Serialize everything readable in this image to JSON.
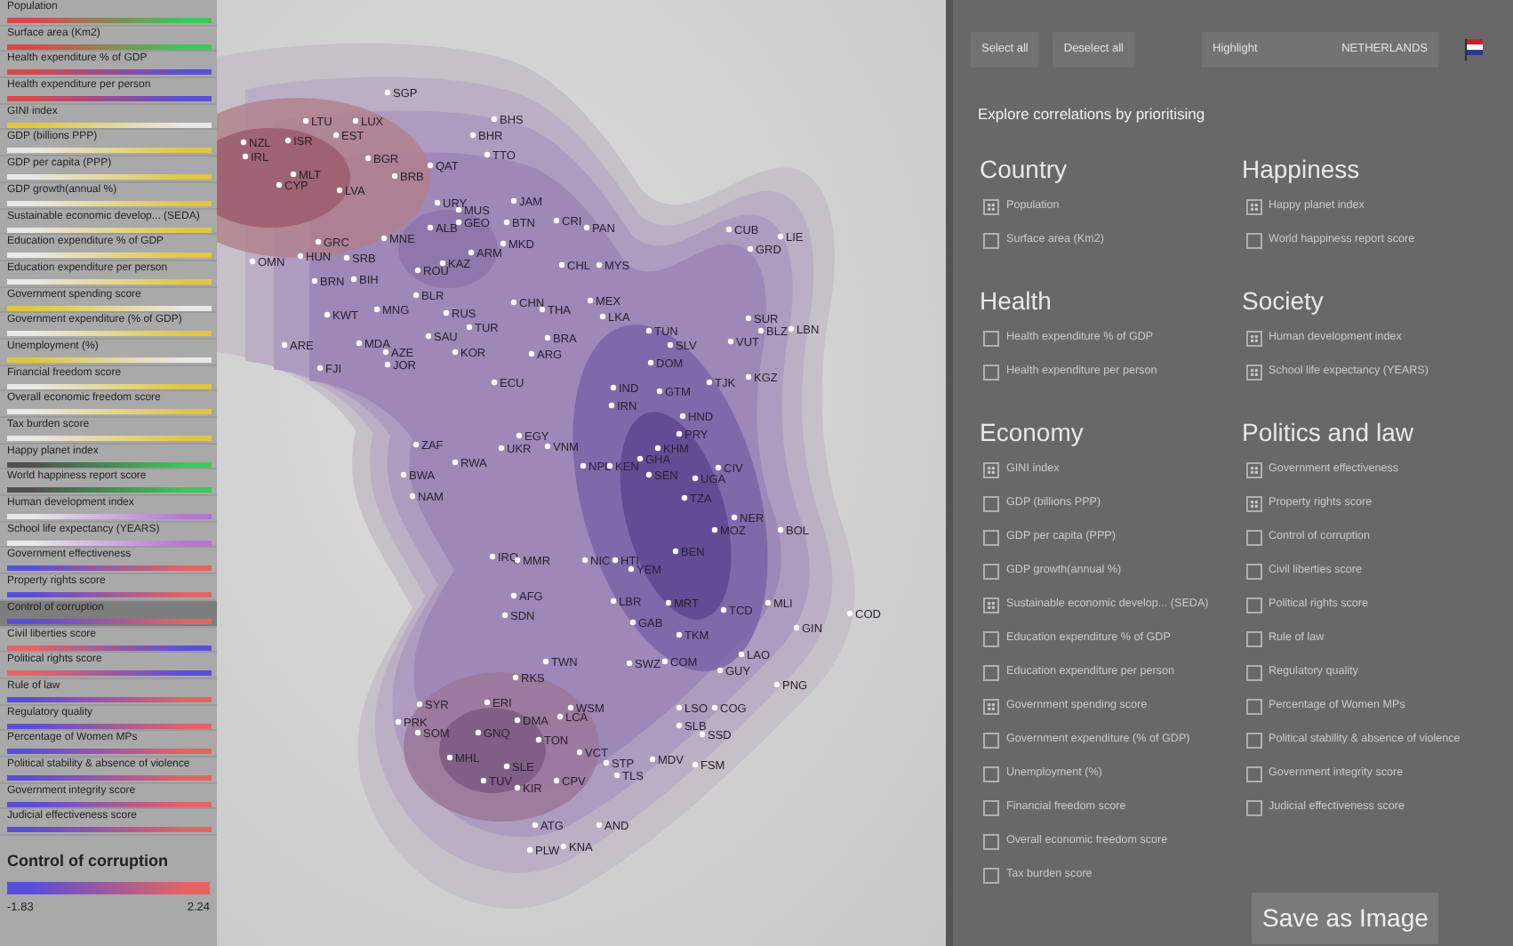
{
  "sidebar": {
    "variables": [
      {
        "label": "Population",
        "gradient": [
          {
            "color": "#d94848"
          },
          {
            "color": "#3cc85a"
          }
        ],
        "selected": false
      },
      {
        "label": "Surface area (Km2)",
        "gradient": [
          {
            "color": "#d94848"
          },
          {
            "color": "#3cc85a"
          }
        ],
        "selected": false
      },
      {
        "label": "Health expenditure % of GDP",
        "gradient": [
          {
            "color": "#d94848"
          },
          {
            "color": "#5a4ed8"
          }
        ],
        "selected": false
      },
      {
        "label": "Health expenditure per person",
        "gradient": [
          {
            "color": "#d94848"
          },
          {
            "color": "#5a4ed8"
          }
        ],
        "selected": false
      },
      {
        "label": "GINI index",
        "gradient": [
          {
            "color": "#e0c640"
          },
          {
            "color": "#e8e8e8"
          }
        ],
        "selected": false
      },
      {
        "label": "GDP (billions PPP)",
        "gradient": [
          {
            "color": "#e8e8e8"
          },
          {
            "color": "#e0c640"
          }
        ],
        "selected": false
      },
      {
        "label": "GDP per capita (PPP)",
        "gradient": [
          {
            "color": "#e8e8e8"
          },
          {
            "color": "#e0c640"
          }
        ],
        "selected": false
      },
      {
        "label": "GDP growth(annual %)",
        "gradient": [
          {
            "color": "#e8e8e8"
          },
          {
            "color": "#e0c640"
          }
        ],
        "selected": false
      },
      {
        "label": "Sustainable economic develop... (SEDA)",
        "gradient": [
          {
            "color": "#e8e8e8"
          },
          {
            "color": "#e0c640"
          }
        ],
        "selected": false
      },
      {
        "label": "Education expenditure % of GDP",
        "gradient": [
          {
            "color": "#e8e8e8"
          },
          {
            "color": "#e0c640"
          }
        ],
        "selected": false
      },
      {
        "label": "Education expenditure per person",
        "gradient": [
          {
            "color": "#e8e8e8"
          },
          {
            "color": "#e0c640"
          }
        ],
        "selected": false
      },
      {
        "label": "Government spending score",
        "gradient": [
          {
            "color": "#e0c640"
          },
          {
            "color": "#e8e8e8"
          }
        ],
        "selected": false
      },
      {
        "label": "Government expenditure (% of GDP)",
        "gradient": [
          {
            "color": "#e8e8e8"
          },
          {
            "color": "#e0c640"
          }
        ],
        "selected": false
      },
      {
        "label": "Unemployment (%)",
        "gradient": [
          {
            "color": "#e0c640"
          },
          {
            "color": "#e8e8e8"
          }
        ],
        "selected": false
      },
      {
        "label": "Financial freedom score",
        "gradient": [
          {
            "color": "#e8e8e8"
          },
          {
            "color": "#e0c640"
          }
        ],
        "selected": false
      },
      {
        "label": "Overall economic freedom score",
        "gradient": [
          {
            "color": "#e8e8e8"
          },
          {
            "color": "#e0c640"
          }
        ],
        "selected": false
      },
      {
        "label": "Tax burden score",
        "gradient": [
          {
            "color": "#e8e8e8"
          },
          {
            "color": "#e0c640"
          }
        ],
        "selected": false
      },
      {
        "label": "Happy planet index",
        "gradient": [
          {
            "color": "#505050"
          },
          {
            "color": "#3cc85a"
          }
        ],
        "selected": false
      },
      {
        "label": "World happiness report score",
        "gradient": [
          {
            "color": "#505050"
          },
          {
            "color": "#3cc85a"
          }
        ],
        "selected": false
      },
      {
        "label": "Human development index",
        "gradient": [
          {
            "color": "#e8e8e8"
          },
          {
            "color": "#b474d4"
          }
        ],
        "selected": false
      },
      {
        "label": "School life expectancy (YEARS)",
        "gradient": [
          {
            "color": "#e8e8e8"
          },
          {
            "color": "#b474d4"
          }
        ],
        "selected": false
      },
      {
        "label": "Government effectiveness",
        "gradient": [
          {
            "color": "#5a4ed8"
          },
          {
            "color": "#e46464"
          }
        ],
        "selected": false
      },
      {
        "label": "Property rights score",
        "gradient": [
          {
            "color": "#5a4ed8"
          },
          {
            "color": "#e46464"
          }
        ],
        "selected": false
      },
      {
        "label": "Control of corruption",
        "gradient": [
          {
            "color": "#5a4ed8"
          },
          {
            "color": "#e46464"
          }
        ],
        "selected": true
      },
      {
        "label": "Civil liberties score",
        "gradient": [
          {
            "color": "#e46464"
          },
          {
            "color": "#5a4ed8"
          }
        ],
        "selected": false
      },
      {
        "label": "Political rights score",
        "gradient": [
          {
            "color": "#e46464"
          },
          {
            "color": "#5a4ed8"
          }
        ],
        "selected": false
      },
      {
        "label": "Rule of law",
        "gradient": [
          {
            "color": "#5a4ed8"
          },
          {
            "color": "#e46464"
          }
        ],
        "selected": false
      },
      {
        "label": "Regulatory quality",
        "gradient": [
          {
            "color": "#5a4ed8"
          },
          {
            "color": "#e46464"
          }
        ],
        "selected": false
      },
      {
        "label": "Percentage of Women MPs",
        "gradient": [
          {
            "color": "#5a4ed8"
          },
          {
            "color": "#e46464"
          }
        ],
        "selected": false
      },
      {
        "label": "Political stability & absence of violence",
        "gradient": [
          {
            "color": "#5a4ed8"
          },
          {
            "color": "#e46464"
          }
        ],
        "selected": false
      },
      {
        "label": "Government integrity score",
        "gradient": [
          {
            "color": "#5a4ed8"
          },
          {
            "color": "#e46464"
          }
        ],
        "selected": false
      },
      {
        "label": "Judicial effectiveness score",
        "gradient": [
          {
            "color": "#5a4ed8"
          },
          {
            "color": "#e46464"
          }
        ],
        "selected": false
      }
    ]
  },
  "legend": {
    "title": "Control of corruption",
    "min": "-1.83",
    "max": "2.24",
    "gradient": [
      {
        "color": "#5a4ed8"
      },
      {
        "color": "#e46464"
      }
    ]
  },
  "map": {
    "points": [
      {
        "label": "SGP"
      },
      {
        "label": "LTU"
      },
      {
        "label": "LUX"
      },
      {
        "label": "BHS"
      },
      {
        "label": "EST"
      },
      {
        "label": "BHR"
      },
      {
        "label": "NZL"
      },
      {
        "label": "ISR"
      },
      {
        "label": "IRL"
      },
      {
        "label": "TTO"
      },
      {
        "label": "BGR"
      },
      {
        "label": "QAT"
      },
      {
        "label": "BRB"
      },
      {
        "label": "MLT"
      },
      {
        "label": "CYP"
      },
      {
        "label": "LVA"
      },
      {
        "label": "JAM"
      },
      {
        "label": "URY"
      },
      {
        "label": "MUS"
      },
      {
        "label": "ALB"
      },
      {
        "label": "GEO"
      },
      {
        "label": "BTN"
      },
      {
        "label": "CRI"
      },
      {
        "label": "PAN"
      },
      {
        "label": "GRC"
      },
      {
        "label": "MNE"
      },
      {
        "label": "MKD"
      },
      {
        "label": "ARM"
      },
      {
        "label": "OMN"
      },
      {
        "label": "HUN"
      },
      {
        "label": "SRB"
      },
      {
        "label": "ROU"
      },
      {
        "label": "KAZ"
      },
      {
        "label": "BRN"
      },
      {
        "label": "BIH"
      },
      {
        "label": "BLR"
      },
      {
        "label": "CHN"
      },
      {
        "label": "THA"
      },
      {
        "label": "KWT"
      },
      {
        "label": "MNG"
      },
      {
        "label": "RUS"
      },
      {
        "label": "TUR"
      },
      {
        "label": "MDA"
      },
      {
        "label": "AZE"
      },
      {
        "label": "SAU"
      },
      {
        "label": "KOR"
      },
      {
        "label": "BRA"
      },
      {
        "label": "ARE"
      },
      {
        "label": "FJI"
      },
      {
        "label": "JOR"
      },
      {
        "label": "ARG"
      },
      {
        "label": "ECU"
      },
      {
        "label": "CHL"
      },
      {
        "label": "MYS"
      },
      {
        "label": "CUB"
      },
      {
        "label": "LIE"
      },
      {
        "label": "GRD"
      },
      {
        "label": "MEX"
      },
      {
        "label": "LKA"
      },
      {
        "label": "TUN"
      },
      {
        "label": "SLV"
      },
      {
        "label": "SUR"
      },
      {
        "label": "BLZ"
      },
      {
        "label": "LBN"
      },
      {
        "label": "VUT"
      },
      {
        "label": "DOM"
      },
      {
        "label": "KGZ"
      },
      {
        "label": "TJK"
      },
      {
        "label": "IND"
      },
      {
        "label": "GTM"
      },
      {
        "label": "IRN"
      },
      {
        "label": "HND"
      },
      {
        "label": "PRY"
      },
      {
        "label": "KHM"
      },
      {
        "label": "GHA"
      },
      {
        "label": "KEN"
      },
      {
        "label": "CIV"
      },
      {
        "label": "SEN"
      },
      {
        "label": "ZAF"
      },
      {
        "label": "EGY"
      },
      {
        "label": "UKR"
      },
      {
        "label": "VNM"
      },
      {
        "label": "RWA"
      },
      {
        "label": "NPL"
      },
      {
        "label": "BWA"
      },
      {
        "label": "NAM"
      },
      {
        "label": "UGA"
      },
      {
        "label": "TZA"
      },
      {
        "label": "NER"
      },
      {
        "label": "BOL"
      },
      {
        "label": "MOZ"
      },
      {
        "label": "BEN"
      },
      {
        "label": "IRQ"
      },
      {
        "label": "MMR"
      },
      {
        "label": "NIC"
      },
      {
        "label": "HTI"
      },
      {
        "label": "YEM"
      },
      {
        "label": "AFG"
      },
      {
        "label": "SDN"
      },
      {
        "label": "LBR"
      },
      {
        "label": "MRT"
      },
      {
        "label": "TCD"
      },
      {
        "label": "MLI"
      },
      {
        "label": "COD"
      },
      {
        "label": "GAB"
      },
      {
        "label": "TKM"
      },
      {
        "label": "LAO"
      },
      {
        "label": "GIN"
      },
      {
        "label": "TWN"
      },
      {
        "label": "SWZ"
      },
      {
        "label": "COM"
      },
      {
        "label": "GUY"
      },
      {
        "label": "PNG"
      },
      {
        "label": "RKS"
      },
      {
        "label": "SYR"
      },
      {
        "label": "ERI"
      },
      {
        "label": "WSM"
      },
      {
        "label": "DMA"
      },
      {
        "label": "LCA"
      },
      {
        "label": "PRK"
      },
      {
        "label": "SOM"
      },
      {
        "label": "GNQ"
      },
      {
        "label": "TON"
      },
      {
        "label": "LSO"
      },
      {
        "label": "COG"
      },
      {
        "label": "SLB"
      },
      {
        "label": "SSD"
      },
      {
        "label": "VCT"
      },
      {
        "label": "STP"
      },
      {
        "label": "MDV"
      },
      {
        "label": "FSM"
      },
      {
        "label": "TLS"
      },
      {
        "label": "SLE"
      },
      {
        "label": "CPV"
      },
      {
        "label": "KIR"
      },
      {
        "label": "ATG"
      },
      {
        "label": "AND"
      },
      {
        "label": "PLW"
      },
      {
        "label": "KNA"
      },
      {
        "label": "MHL"
      },
      {
        "label": "TUV"
      }
    ]
  },
  "panel": {
    "buttons": [
      "Select all",
      "Deselect all"
    ],
    "highlight": {
      "label": "Highlight",
      "value": "NETHERLANDS"
    },
    "intro": "Explore correlations by prioritising",
    "columns": [
      [
        {
          "title": "Country",
          "items": [
            {
              "label": "Population",
              "checked": true
            },
            {
              "label": "Surface area (Km2)",
              "checked": false
            }
          ]
        },
        {
          "title": "Health",
          "items": [
            {
              "label": "Health expenditure % of GDP",
              "checked": false
            },
            {
              "label": "Health expenditure per person",
              "checked": false
            }
          ]
        },
        {
          "title": "Economy",
          "items": [
            {
              "label": "GINI index",
              "checked": true
            },
            {
              "label": "GDP (billions PPP)",
              "checked": false
            },
            {
              "label": "GDP per capita (PPP)",
              "checked": false
            },
            {
              "label": "GDP growth(annual %)",
              "checked": false
            },
            {
              "label": "Sustainable economic develop... (SEDA)",
              "checked": true
            },
            {
              "label": "Education expenditure % of GDP",
              "checked": false
            },
            {
              "label": "Education expenditure per person",
              "checked": false
            },
            {
              "label": "Government spending score",
              "checked": true
            },
            {
              "label": "Government expenditure (% of GDP)",
              "checked": false
            },
            {
              "label": "Unemployment (%)",
              "checked": false
            },
            {
              "label": "Financial freedom score",
              "checked": false
            },
            {
              "label": "Overall economic freedom score",
              "checked": false
            },
            {
              "label": "Tax burden score",
              "checked": false
            }
          ]
        }
      ],
      [
        {
          "title": "Happiness",
          "items": [
            {
              "label": "Happy planet index",
              "checked": true
            },
            {
              "label": "World happiness report score",
              "checked": false
            }
          ]
        },
        {
          "title": "Society",
          "items": [
            {
              "label": "Human development index",
              "checked": true
            },
            {
              "label": "School life expectancy (YEARS)",
              "checked": true
            }
          ]
        },
        {
          "title": "Politics and law",
          "items": [
            {
              "label": "Government effectiveness",
              "checked": true
            },
            {
              "label": "Property rights score",
              "checked": true
            },
            {
              "label": "Control of corruption",
              "checked": false
            },
            {
              "label": "Civil liberties score",
              "checked": false
            },
            {
              "label": "Political rights score",
              "checked": false
            },
            {
              "label": "Rule of law",
              "checked": false
            },
            {
              "label": "Regulatory quality",
              "checked": false
            },
            {
              "label": "Percentage of Women MPs",
              "checked": false
            },
            {
              "label": "Political stability & absence of violence",
              "checked": false
            },
            {
              "label": "Government integrity score",
              "checked": false
            },
            {
              "label": "Judicial effectiveness score",
              "checked": false
            }
          ]
        }
      ]
    ],
    "save_button": "Save as Image"
  }
}
